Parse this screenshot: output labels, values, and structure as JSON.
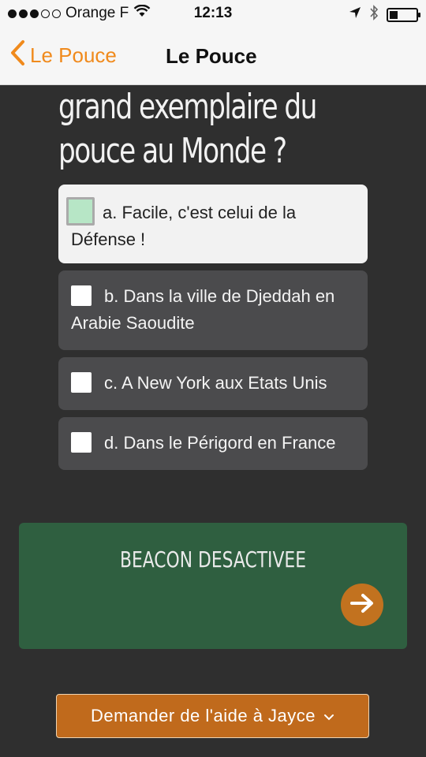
{
  "status_bar": {
    "carrier": "Orange F",
    "time": "12:13",
    "signal_filled": 3,
    "signal_total": 5,
    "battery_level": 0.3
  },
  "nav": {
    "back_label": "Le Pouce",
    "title": "Le Pouce",
    "accent_color": "#f08a1c"
  },
  "question": {
    "lines": [
      "grand exemplaire du",
      "pouce au Monde ?"
    ]
  },
  "answers": [
    {
      "label": "a. Facile, c'est celui de la Défense !",
      "selected": true
    },
    {
      "label": "b. Dans la ville de Djeddah en Arabie Saoudite",
      "selected": false
    },
    {
      "label": "c. A New York aux Etats Unis",
      "selected": false
    },
    {
      "label": "d. Dans le Périgord en France",
      "selected": false
    }
  ],
  "beacon": {
    "status": "BEACON DESACTIVEE",
    "color": "#2f5f40"
  },
  "help": {
    "label": "Demander de l'aide à Jayce",
    "color": "#c06a1c"
  }
}
